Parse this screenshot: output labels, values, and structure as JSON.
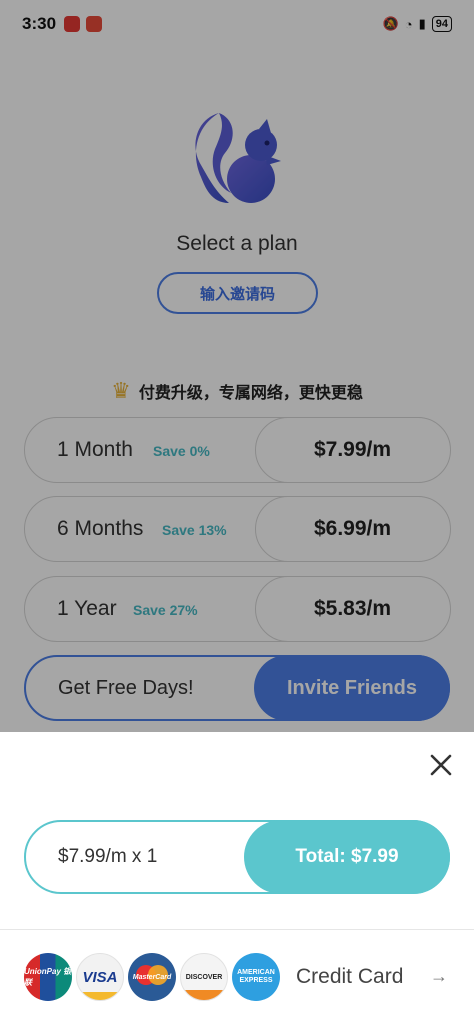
{
  "status_bar": {
    "time": "3:30",
    "battery": "94"
  },
  "header": {
    "title": "Select a plan",
    "invite_code_label": "输入邀请码"
  },
  "slogan": "付费升级，专属网络，更快更稳",
  "plans": [
    {
      "name": "1 Month",
      "save": "Save 0%",
      "price": "$7.99/m"
    },
    {
      "name": "6 Months",
      "save": "Save 13%",
      "price": "$6.99/m"
    },
    {
      "name": "1 Year",
      "save": "Save 27%",
      "price": "$5.83/m"
    }
  ],
  "friends": {
    "label": "Get Free Days!",
    "button": "Invite Friends"
  },
  "checkout": {
    "quantity_text": "$7.99/m x 1",
    "total_text": "Total: $7.99",
    "payment_method": "Credit Card",
    "cards": [
      "UnionPay 银联",
      "VISA",
      "MasterCard",
      "DISCOVER",
      "AMERICAN EXPRESS"
    ]
  },
  "colors": {
    "primary": "#4d7fe6",
    "accent": "#5bc6cd",
    "save_text": "#47b8c4"
  }
}
